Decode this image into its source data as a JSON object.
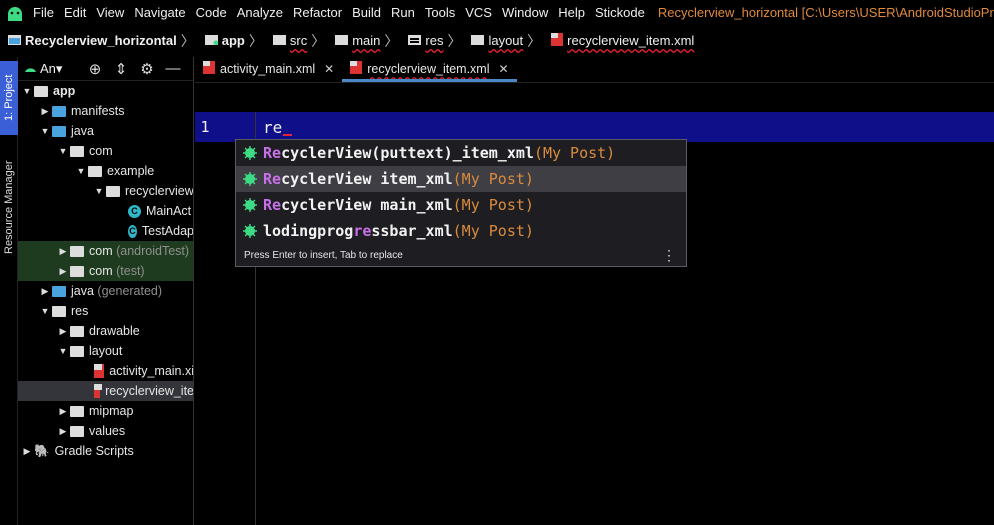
{
  "menu": {
    "items": [
      "File",
      "Edit",
      "View",
      "Navigate",
      "Code",
      "Analyze",
      "Refactor",
      "Build",
      "Run",
      "Tools",
      "VCS",
      "Window",
      "Help",
      "Stickode"
    ],
    "window_title": "Recyclerview_horizontal [C:\\Users\\USER\\AndroidStudioProject"
  },
  "breadcrumb": [
    "Recyclerview_horizontal",
    "app",
    "src",
    "main",
    "res",
    "layout",
    "recyclerview_item.xml"
  ],
  "side_strip": {
    "project_tab": "1: Project",
    "resource_tab": "Resource Manager"
  },
  "project_panel": {
    "view_selector": "An▾",
    "tree": {
      "app": "app",
      "manifests": "manifests",
      "java": "java",
      "com": "com",
      "example": "example",
      "recyclerview": "recyclerview",
      "main_activity": "MainAct",
      "test_adapter": "TestAdap",
      "com_android_test": "com",
      "android_test_tag": "(androidTest)",
      "com_test": "com",
      "test_tag": "(test)",
      "java_generated": "java",
      "generated_tag": "(generated)",
      "res": "res",
      "drawable": "drawable",
      "layout": "layout",
      "activity_main": "activity_main.xi",
      "recyclerview_item": "recyclerview_ite",
      "mipmap": "mipmap",
      "values": "values",
      "gradle_scripts": "Gradle Scripts"
    }
  },
  "editor": {
    "tabs": [
      "activity_main.xml",
      "recyclerview_item.xml"
    ],
    "active_tab": "recyclerview_item.xml",
    "line_number": "1",
    "code": "re"
  },
  "completion": {
    "suggestions": [
      {
        "match": "Re",
        "mid": "cyclerView(puttext)_item_xml",
        "tail": "(My Post)"
      },
      {
        "match": "Re",
        "mid": "cyclerView item_xml",
        "tail": "(My Post)"
      },
      {
        "match": "Re",
        "mid": "cyclerView main_xml",
        "tail": "(My Post)"
      },
      {
        "pre": "lodingprog",
        "match": "re",
        "mid": "ssbar_xml",
        "tail": "(My Post)"
      }
    ],
    "selected_index": 1,
    "footer": "Press Enter to insert, Tab to replace"
  },
  "colors": {
    "accent": "#3b5fd6",
    "current_line": "#0f0f8a",
    "title": "#e08a3c",
    "match": "#c770e8",
    "tail": "#d98b3c"
  }
}
